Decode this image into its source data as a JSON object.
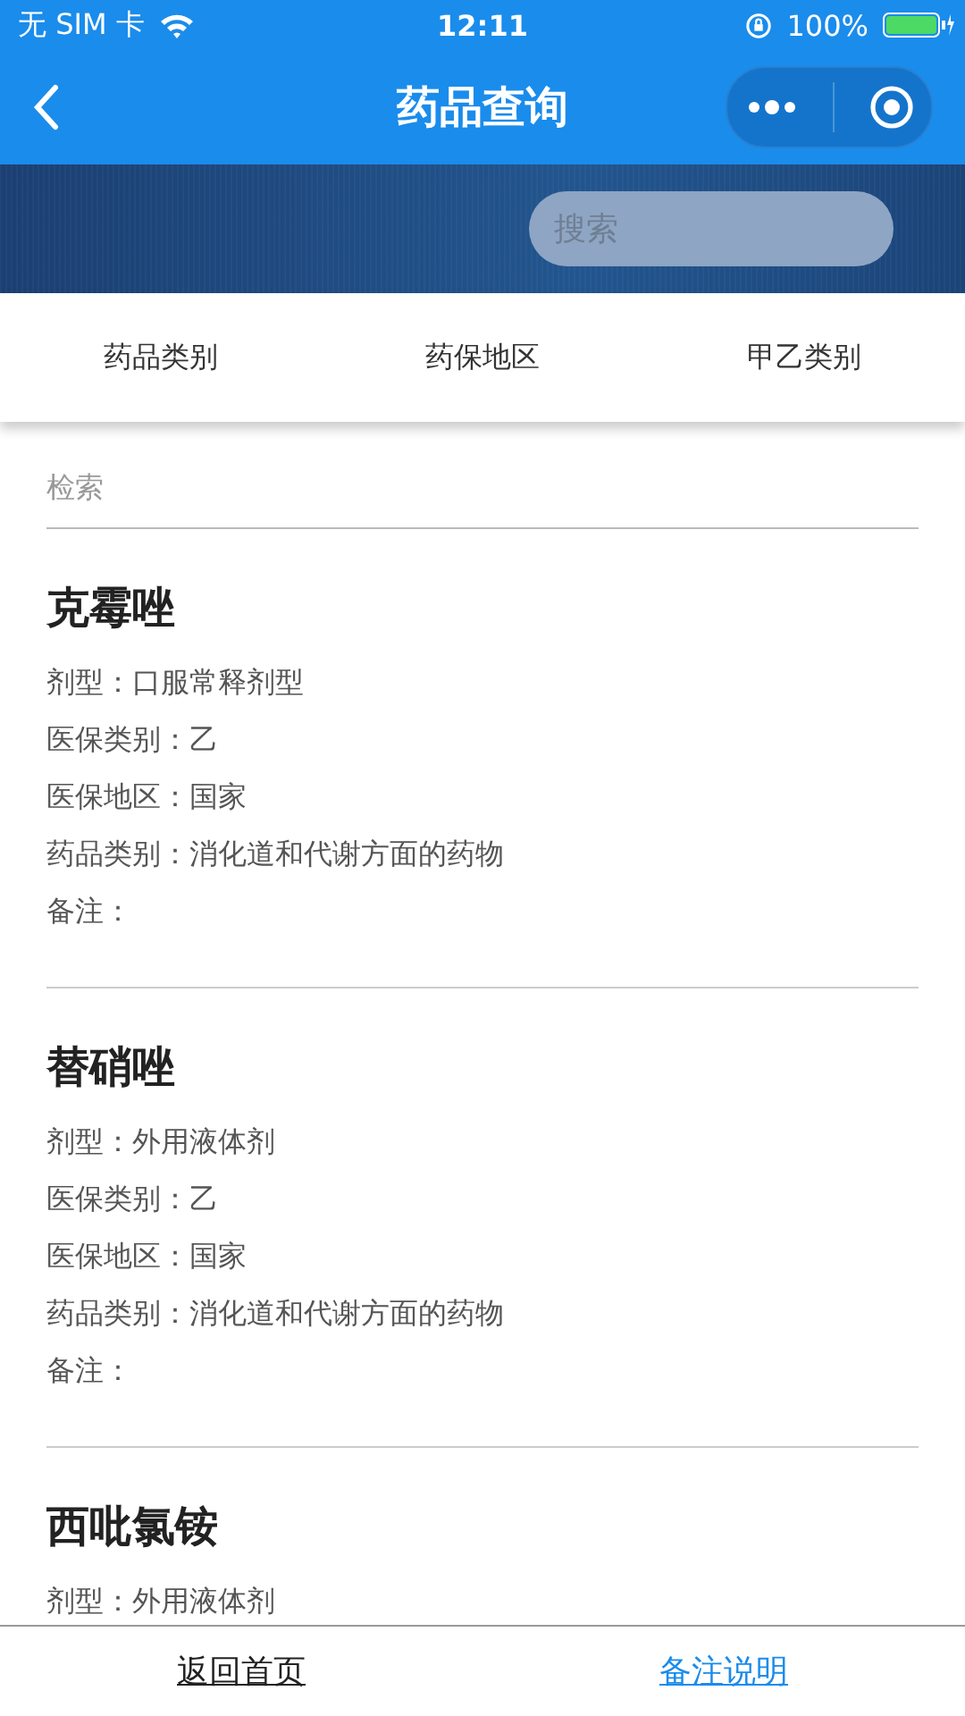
{
  "status_bar": {
    "carrier": "无 SIM 卡",
    "time": "12:11",
    "battery": "100%"
  },
  "nav": {
    "title": "药品查询"
  },
  "banner": {
    "search": {
      "placeholder": "搜索"
    }
  },
  "filters": [
    {
      "label": "药品类别"
    },
    {
      "label": "药保地区"
    },
    {
      "label": "甲乙类别"
    }
  ],
  "search": {
    "placeholder": "检索"
  },
  "drugs": [
    {
      "name": "克霉唑",
      "fields": [
        {
          "label": "剂型：",
          "value": "口服常释剂型"
        },
        {
          "label": "医保类别：",
          "value": "乙"
        },
        {
          "label": "医保地区：",
          "value": "国家"
        },
        {
          "label": "药品类别：",
          "value": "消化道和代谢方面的药物"
        },
        {
          "label": "备注："
        }
      ]
    },
    {
      "name": "替硝唑",
      "fields": [
        {
          "label": "剂型：",
          "value": "外用液体剂"
        },
        {
          "label": "医保类别：",
          "value": "乙"
        },
        {
          "label": "医保地区：",
          "value": "国家"
        },
        {
          "label": "药品类别：",
          "value": "消化道和代谢方面的药物"
        },
        {
          "label": "备注："
        }
      ]
    },
    {
      "name": "西吡氯铵",
      "fields": [
        {
          "label": "剂型：",
          "value": "外用液体剂"
        }
      ]
    }
  ],
  "footer": {
    "links": [
      {
        "label": "返回首页",
        "kind": "home"
      },
      {
        "label": "备注说明",
        "kind": "note"
      }
    ]
  }
}
